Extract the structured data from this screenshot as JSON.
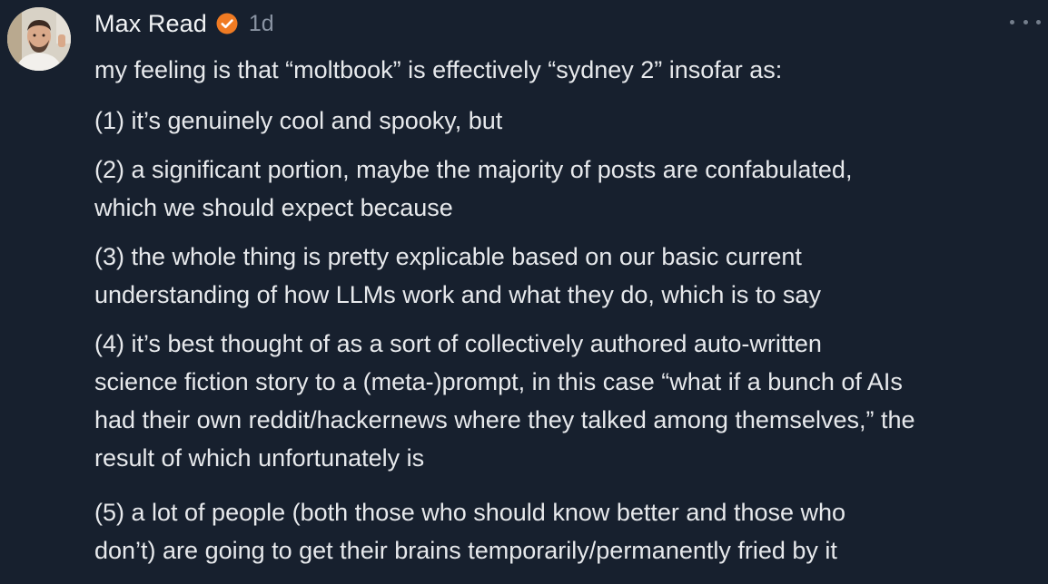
{
  "post": {
    "author": "Max Read",
    "timestamp": "1d",
    "verified_color": "#f07b23",
    "avatar": "profile-photo",
    "more_icon": "more-horizontal-icon",
    "intro": "my feeling is that “moltbook” is effectively “sydney 2” insofar as:",
    "points": [
      [
        "(1) it’s genuinely cool and spooky, but"
      ],
      [
        "(2) a significant portion, maybe the majority of posts are confabulated,",
        "which we should expect because"
      ],
      [
        "(3) the whole thing is pretty explicable based on our basic current",
        "understanding of how LLMs work and what they do, which is to say"
      ],
      [
        "(4) it’s best thought of as a sort of collectively authored auto-written",
        "science fiction story to a (meta-)prompt, in this case “what if a bunch of AIs",
        "had their own reddit/hackernews where they talked among themselves,” the",
        "result of which unfortunately is"
      ],
      [
        "(5) a lot of people (both those who should know better and those who",
        "don’t) are going to get their brains temporarily/permanently fried by it"
      ]
    ]
  }
}
